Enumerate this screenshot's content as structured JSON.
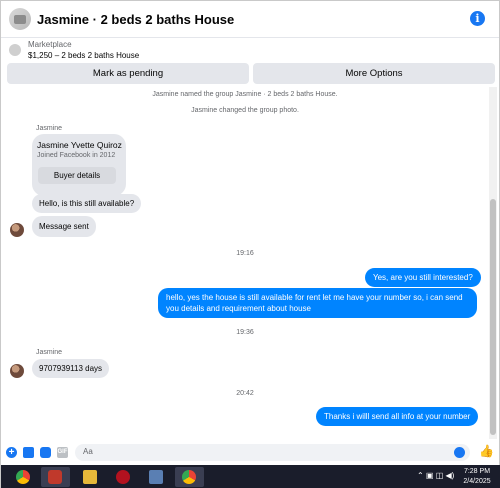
{
  "header": {
    "title": "Jasmine · 2 beds 2 baths House"
  },
  "marketplace": {
    "label": "Marketplace",
    "item": "$1,250 – 2 beds 2 baths House"
  },
  "actions": {
    "pending": "Mark as pending",
    "more": "More Options"
  },
  "chat": {
    "system_messages": [
      "Jasmine named the group Jasmine · 2 beds 2 baths House.",
      "Jasmine changed the group photo."
    ],
    "sender_name": "Jasmine",
    "profile_card": {
      "name": "Jasmine Yvette Quiroz",
      "joined": "Joined Facebook in 2012",
      "button": "Buyer details"
    },
    "incoming": [
      "Hello, is this still available?",
      "Message sent",
      "9707939113 days"
    ],
    "timestamps": [
      "19:16",
      "19:36",
      "20:42"
    ],
    "outgoing": [
      "Yes, are you still interested?",
      "hello, yes the house is still available for rent  let me have your number so, i can send",
      "you details and requirement about house",
      "Thanks i willl send all info at your number"
    ]
  },
  "composer": {
    "placeholder": "Aa"
  },
  "icons": {
    "header": [
      "group-avatar",
      "info-icon"
    ],
    "composer": [
      "plus-icon",
      "photo-icon",
      "sticker-icon",
      "gif-icon",
      "emoji-icon",
      "thumbs-up-icon"
    ]
  },
  "colors": {
    "accent": "#1877f2",
    "outgoing_bubble": "#0084ff",
    "incoming_bubble": "#e4e6eb",
    "taskbar": "#1a1d2b"
  },
  "taskbar": {
    "apps": [
      "chrome-icon",
      "app-icon-red",
      "file-explorer-icon",
      "antivirus-icon",
      "computer-icon",
      "chrome-icon-active"
    ],
    "clock": {
      "time": "7:28 PM",
      "date": "2/4/2025"
    }
  }
}
